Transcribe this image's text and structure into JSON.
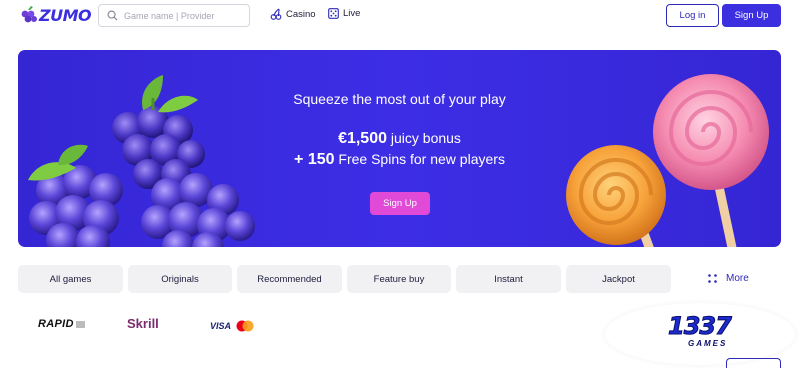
{
  "brand": {
    "name": "ZUMO",
    "accent": "#3b2fe0",
    "cta_color": "#e14ad6"
  },
  "header": {
    "search": {
      "placeholder": "Game name | Provider"
    },
    "nav": [
      {
        "label": "Casino",
        "icon": "cherries-icon"
      },
      {
        "label": "Live",
        "icon": "dice-icon"
      }
    ],
    "login_label": "Log in",
    "signup_label": "Sign Up"
  },
  "banner": {
    "tagline": "Squeeze the most out of your play",
    "bonus_amount": "€1,500",
    "bonus_text": " juicy bonus",
    "spins_amount": "+ 150",
    "spins_text": " Free Spins for new players",
    "cta_label": "Sign Up"
  },
  "tabs": [
    {
      "label": "All games"
    },
    {
      "label": "Originals"
    },
    {
      "label": "Recommended"
    },
    {
      "label": "Feature buy"
    },
    {
      "label": "Instant"
    },
    {
      "label": "Jackpot"
    }
  ],
  "more_label": "More",
  "payments": {
    "rapid": "RAPID",
    "skrill": "Skrill",
    "visa": "VISA",
    "games_number": "1337",
    "games_word": "GAMES"
  }
}
